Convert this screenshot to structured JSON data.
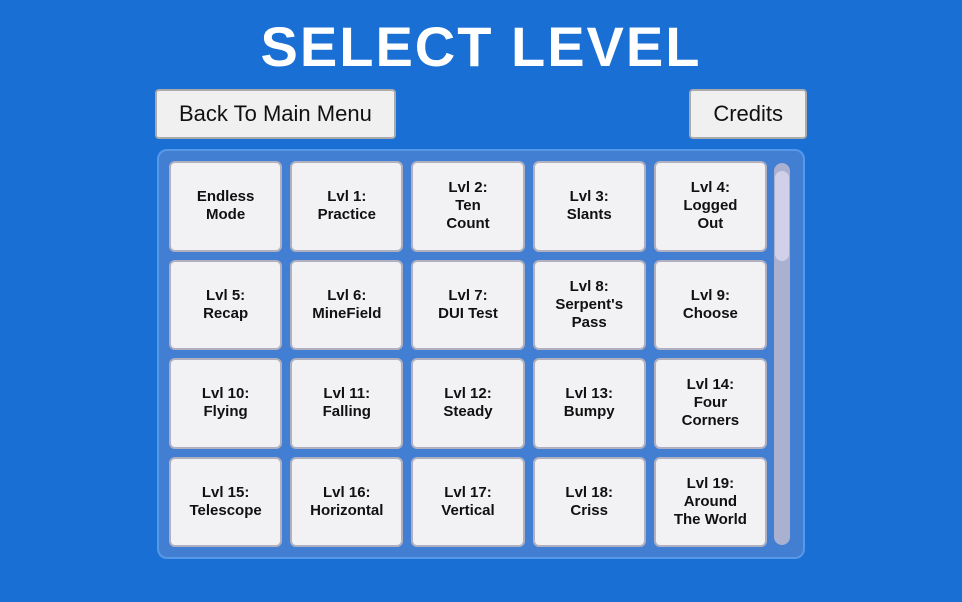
{
  "title": "SELECT LEVEL",
  "buttons": {
    "back": "Back To Main Menu",
    "credits": "Credits"
  },
  "levels": [
    "Endless\nMode",
    "Lvl 1:\nPractice",
    "Lvl 2:\nTen\nCount",
    "Lvl 3:\nSlants",
    "Lvl 4:\nLogged\nOut",
    "Lvl 5:\nRecap",
    "Lvl 6:\nMineField",
    "Lvl 7:\nDUI Test",
    "Lvl 8:\nSerpent's\nPass",
    "Lvl 9:\nChoose",
    "Lvl 10:\nFlying",
    "Lvl 11:\nFalling",
    "Lvl 12:\nSteady",
    "Lvl 13:\nBumpy",
    "Lvl 14:\nFour\nCorners",
    "Lvl 15:\nTelescope",
    "Lvl 16:\nHorizontal",
    "Lvl 17:\nVertical",
    "Lvl 18:\nCriss",
    "Lvl 19:\nAround\nThe World"
  ]
}
